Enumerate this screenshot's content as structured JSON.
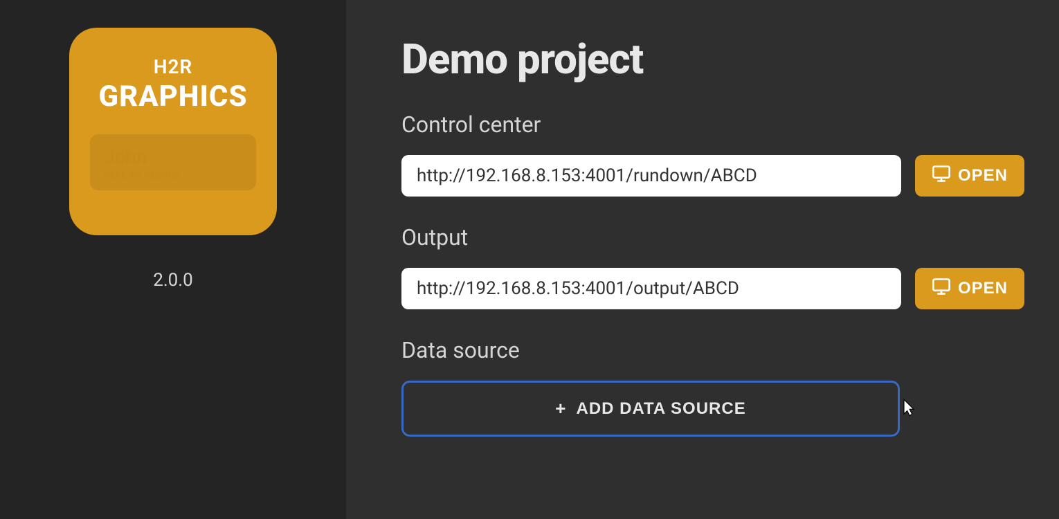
{
  "sidebar": {
    "logo": {
      "line1": "H2R",
      "line2": "GRAPHICS",
      "badge_name": "John",
      "badge_sub": "HERE TO RECORD"
    },
    "version": "2.0.0"
  },
  "main": {
    "title": "Demo project",
    "sections": {
      "control_center": {
        "heading": "Control center",
        "url": "http://192.168.8.153:4001/rundown/ABCD",
        "open_label": "OPEN"
      },
      "output": {
        "heading": "Output",
        "url": "http://192.168.8.153:4001/output/ABCD",
        "open_label": "OPEN"
      },
      "data_source": {
        "heading": "Data source",
        "add_button_label": "ADD DATA SOURCE"
      }
    }
  },
  "colors": {
    "accent": "#d99a1e",
    "border_focus": "#3a68c5",
    "bg_sidebar": "#242424",
    "bg_main": "#2f2f2f"
  }
}
